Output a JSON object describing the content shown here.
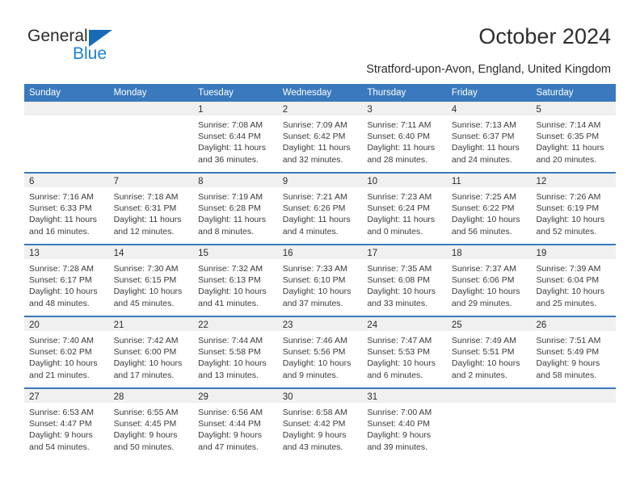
{
  "brand": {
    "name_part1": "General",
    "name_part2": "Blue",
    "triangle_icon": "triangle-icon",
    "colors": {
      "blue": "#1b7fd4",
      "dark": "#2b2b2b",
      "triangle": "#1a6bb5"
    }
  },
  "header": {
    "title": "October 2024",
    "subtitle": "Stratford-upon-Avon, England, United Kingdom"
  },
  "calendar": {
    "accent_color": "#3a79bd",
    "band_color": "#f0f0f0",
    "weekdays": [
      "Sunday",
      "Monday",
      "Tuesday",
      "Wednesday",
      "Thursday",
      "Friday",
      "Saturday"
    ],
    "weeks": [
      [
        {
          "day": "",
          "sunrise": "",
          "sunset": "",
          "daylight1": "",
          "daylight2": "",
          "empty": true
        },
        {
          "day": "",
          "sunrise": "",
          "sunset": "",
          "daylight1": "",
          "daylight2": "",
          "empty": true
        },
        {
          "day": "1",
          "sunrise": "Sunrise: 7:08 AM",
          "sunset": "Sunset: 6:44 PM",
          "daylight1": "Daylight: 11 hours",
          "daylight2": "and 36 minutes."
        },
        {
          "day": "2",
          "sunrise": "Sunrise: 7:09 AM",
          "sunset": "Sunset: 6:42 PM",
          "daylight1": "Daylight: 11 hours",
          "daylight2": "and 32 minutes."
        },
        {
          "day": "3",
          "sunrise": "Sunrise: 7:11 AM",
          "sunset": "Sunset: 6:40 PM",
          "daylight1": "Daylight: 11 hours",
          "daylight2": "and 28 minutes."
        },
        {
          "day": "4",
          "sunrise": "Sunrise: 7:13 AM",
          "sunset": "Sunset: 6:37 PM",
          "daylight1": "Daylight: 11 hours",
          "daylight2": "and 24 minutes."
        },
        {
          "day": "5",
          "sunrise": "Sunrise: 7:14 AM",
          "sunset": "Sunset: 6:35 PM",
          "daylight1": "Daylight: 11 hours",
          "daylight2": "and 20 minutes."
        }
      ],
      [
        {
          "day": "6",
          "sunrise": "Sunrise: 7:16 AM",
          "sunset": "Sunset: 6:33 PM",
          "daylight1": "Daylight: 11 hours",
          "daylight2": "and 16 minutes."
        },
        {
          "day": "7",
          "sunrise": "Sunrise: 7:18 AM",
          "sunset": "Sunset: 6:31 PM",
          "daylight1": "Daylight: 11 hours",
          "daylight2": "and 12 minutes."
        },
        {
          "day": "8",
          "sunrise": "Sunrise: 7:19 AM",
          "sunset": "Sunset: 6:28 PM",
          "daylight1": "Daylight: 11 hours",
          "daylight2": "and 8 minutes."
        },
        {
          "day": "9",
          "sunrise": "Sunrise: 7:21 AM",
          "sunset": "Sunset: 6:26 PM",
          "daylight1": "Daylight: 11 hours",
          "daylight2": "and 4 minutes."
        },
        {
          "day": "10",
          "sunrise": "Sunrise: 7:23 AM",
          "sunset": "Sunset: 6:24 PM",
          "daylight1": "Daylight: 11 hours",
          "daylight2": "and 0 minutes."
        },
        {
          "day": "11",
          "sunrise": "Sunrise: 7:25 AM",
          "sunset": "Sunset: 6:22 PM",
          "daylight1": "Daylight: 10 hours",
          "daylight2": "and 56 minutes."
        },
        {
          "day": "12",
          "sunrise": "Sunrise: 7:26 AM",
          "sunset": "Sunset: 6:19 PM",
          "daylight1": "Daylight: 10 hours",
          "daylight2": "and 52 minutes."
        }
      ],
      [
        {
          "day": "13",
          "sunrise": "Sunrise: 7:28 AM",
          "sunset": "Sunset: 6:17 PM",
          "daylight1": "Daylight: 10 hours",
          "daylight2": "and 48 minutes."
        },
        {
          "day": "14",
          "sunrise": "Sunrise: 7:30 AM",
          "sunset": "Sunset: 6:15 PM",
          "daylight1": "Daylight: 10 hours",
          "daylight2": "and 45 minutes."
        },
        {
          "day": "15",
          "sunrise": "Sunrise: 7:32 AM",
          "sunset": "Sunset: 6:13 PM",
          "daylight1": "Daylight: 10 hours",
          "daylight2": "and 41 minutes."
        },
        {
          "day": "16",
          "sunrise": "Sunrise: 7:33 AM",
          "sunset": "Sunset: 6:10 PM",
          "daylight1": "Daylight: 10 hours",
          "daylight2": "and 37 minutes."
        },
        {
          "day": "17",
          "sunrise": "Sunrise: 7:35 AM",
          "sunset": "Sunset: 6:08 PM",
          "daylight1": "Daylight: 10 hours",
          "daylight2": "and 33 minutes."
        },
        {
          "day": "18",
          "sunrise": "Sunrise: 7:37 AM",
          "sunset": "Sunset: 6:06 PM",
          "daylight1": "Daylight: 10 hours",
          "daylight2": "and 29 minutes."
        },
        {
          "day": "19",
          "sunrise": "Sunrise: 7:39 AM",
          "sunset": "Sunset: 6:04 PM",
          "daylight1": "Daylight: 10 hours",
          "daylight2": "and 25 minutes."
        }
      ],
      [
        {
          "day": "20",
          "sunrise": "Sunrise: 7:40 AM",
          "sunset": "Sunset: 6:02 PM",
          "daylight1": "Daylight: 10 hours",
          "daylight2": "and 21 minutes."
        },
        {
          "day": "21",
          "sunrise": "Sunrise: 7:42 AM",
          "sunset": "Sunset: 6:00 PM",
          "daylight1": "Daylight: 10 hours",
          "daylight2": "and 17 minutes."
        },
        {
          "day": "22",
          "sunrise": "Sunrise: 7:44 AM",
          "sunset": "Sunset: 5:58 PM",
          "daylight1": "Daylight: 10 hours",
          "daylight2": "and 13 minutes."
        },
        {
          "day": "23",
          "sunrise": "Sunrise: 7:46 AM",
          "sunset": "Sunset: 5:56 PM",
          "daylight1": "Daylight: 10 hours",
          "daylight2": "and 9 minutes."
        },
        {
          "day": "24",
          "sunrise": "Sunrise: 7:47 AM",
          "sunset": "Sunset: 5:53 PM",
          "daylight1": "Daylight: 10 hours",
          "daylight2": "and 6 minutes."
        },
        {
          "day": "25",
          "sunrise": "Sunrise: 7:49 AM",
          "sunset": "Sunset: 5:51 PM",
          "daylight1": "Daylight: 10 hours",
          "daylight2": "and 2 minutes."
        },
        {
          "day": "26",
          "sunrise": "Sunrise: 7:51 AM",
          "sunset": "Sunset: 5:49 PM",
          "daylight1": "Daylight: 9 hours",
          "daylight2": "and 58 minutes."
        }
      ],
      [
        {
          "day": "27",
          "sunrise": "Sunrise: 6:53 AM",
          "sunset": "Sunset: 4:47 PM",
          "daylight1": "Daylight: 9 hours",
          "daylight2": "and 54 minutes."
        },
        {
          "day": "28",
          "sunrise": "Sunrise: 6:55 AM",
          "sunset": "Sunset: 4:45 PM",
          "daylight1": "Daylight: 9 hours",
          "daylight2": "and 50 minutes."
        },
        {
          "day": "29",
          "sunrise": "Sunrise: 6:56 AM",
          "sunset": "Sunset: 4:44 PM",
          "daylight1": "Daylight: 9 hours",
          "daylight2": "and 47 minutes."
        },
        {
          "day": "30",
          "sunrise": "Sunrise: 6:58 AM",
          "sunset": "Sunset: 4:42 PM",
          "daylight1": "Daylight: 9 hours",
          "daylight2": "and 43 minutes."
        },
        {
          "day": "31",
          "sunrise": "Sunrise: 7:00 AM",
          "sunset": "Sunset: 4:40 PM",
          "daylight1": "Daylight: 9 hours",
          "daylight2": "and 39 minutes."
        },
        {
          "day": "",
          "sunrise": "",
          "sunset": "",
          "daylight1": "",
          "daylight2": "",
          "empty": true
        },
        {
          "day": "",
          "sunrise": "",
          "sunset": "",
          "daylight1": "",
          "daylight2": "",
          "empty": true
        }
      ]
    ]
  }
}
